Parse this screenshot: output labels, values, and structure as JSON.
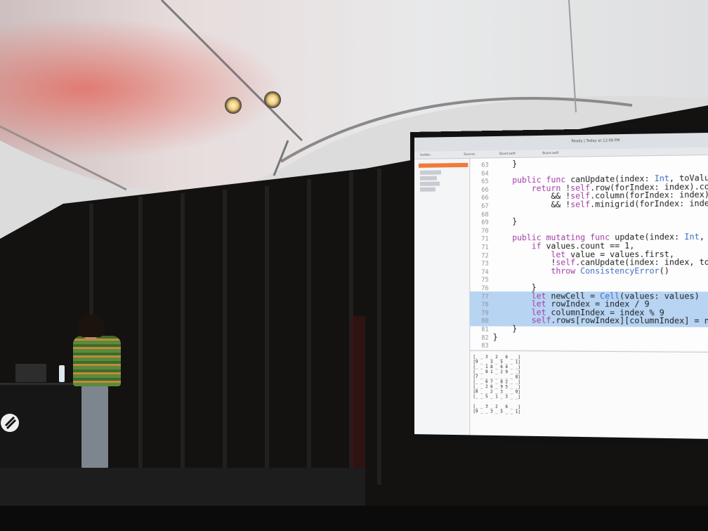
{
  "scene": {
    "description_colors": {
      "tent": "#d9d9d9",
      "curtain": "#141111",
      "screen_bg": "#eef1f5",
      "code_highlight": "#b7d4f2",
      "keyword": "#a23ca6",
      "type": "#3f6ec6"
    }
  },
  "screen": {
    "status": "Ready | Today at 12:09 PM",
    "tabs": [
      "Sudoku",
      "Sources",
      "Board.swift",
      "Board.swift"
    ]
  },
  "code": {
    "lines": [
      {
        "n": "63",
        "text": "    }"
      },
      {
        "n": "64",
        "text": ""
      },
      {
        "n": "65",
        "text": "    public func canUpdate(index: Int, toValue val"
      },
      {
        "n": "66",
        "text": "        return !self.row(forIndex: index).contain"
      },
      {
        "n": "66",
        "text": "            && !self.column(forIndex: index).co"
      },
      {
        "n": "67",
        "text": "            && !self.minigrid(forIndex: index).co"
      },
      {
        "n": "68",
        "text": ""
      },
      {
        "n": "69",
        "text": "    }"
      },
      {
        "n": "70",
        "text": ""
      },
      {
        "n": "71",
        "text": "    public mutating func update(index: Int, value"
      },
      {
        "n": "71",
        "text": "        if values.count == 1,"
      },
      {
        "n": "72",
        "text": "            let value = values.first,"
      },
      {
        "n": "73",
        "text": "            !self.canUpdate(index: index, toValu"
      },
      {
        "n": "74",
        "text": "            throw ConsistencyError()"
      },
      {
        "n": "75",
        "text": ""
      },
      {
        "n": "76",
        "text": "        }"
      },
      {
        "n": "77",
        "text": "        let newCell = Cell(values: values)"
      },
      {
        "n": "78",
        "text": "        let rowIndex = index / 9"
      },
      {
        "n": "79",
        "text": "        let columnIndex = index % 9"
      },
      {
        "n": "80",
        "text": "        self.rows[rowIndex][columnIndex] = newCe"
      },
      {
        "n": "81",
        "text": "    }"
      },
      {
        "n": "82",
        "text": "}"
      },
      {
        "n": "83",
        "text": ""
      }
    ]
  },
  "console": {
    "text": "[_ _ 3 _ 2 _ 6 _ _]\n[9 _ _ 3 _ 5 _ _ 1]\n[_ _ 1 8 _ 6 4 _ _]\n[_ _ 8 1 _ 2 9 _ _]\n[7 _ _ _ _ _ _ _ 8]\n[_ _ 6 7 _ 8 2 _ _]\n[_ _ 2 6 _ 9 5 _ _]\n[8 _ _ 2 _ 3 _ _ 9]\n[_ _ 5 _ 1 _ 3 _ _]\n\n[_ _ 3 _ 2 _ 6 _ _]\n[9 _ _ 3 _ 5 _ _ 1]"
  }
}
